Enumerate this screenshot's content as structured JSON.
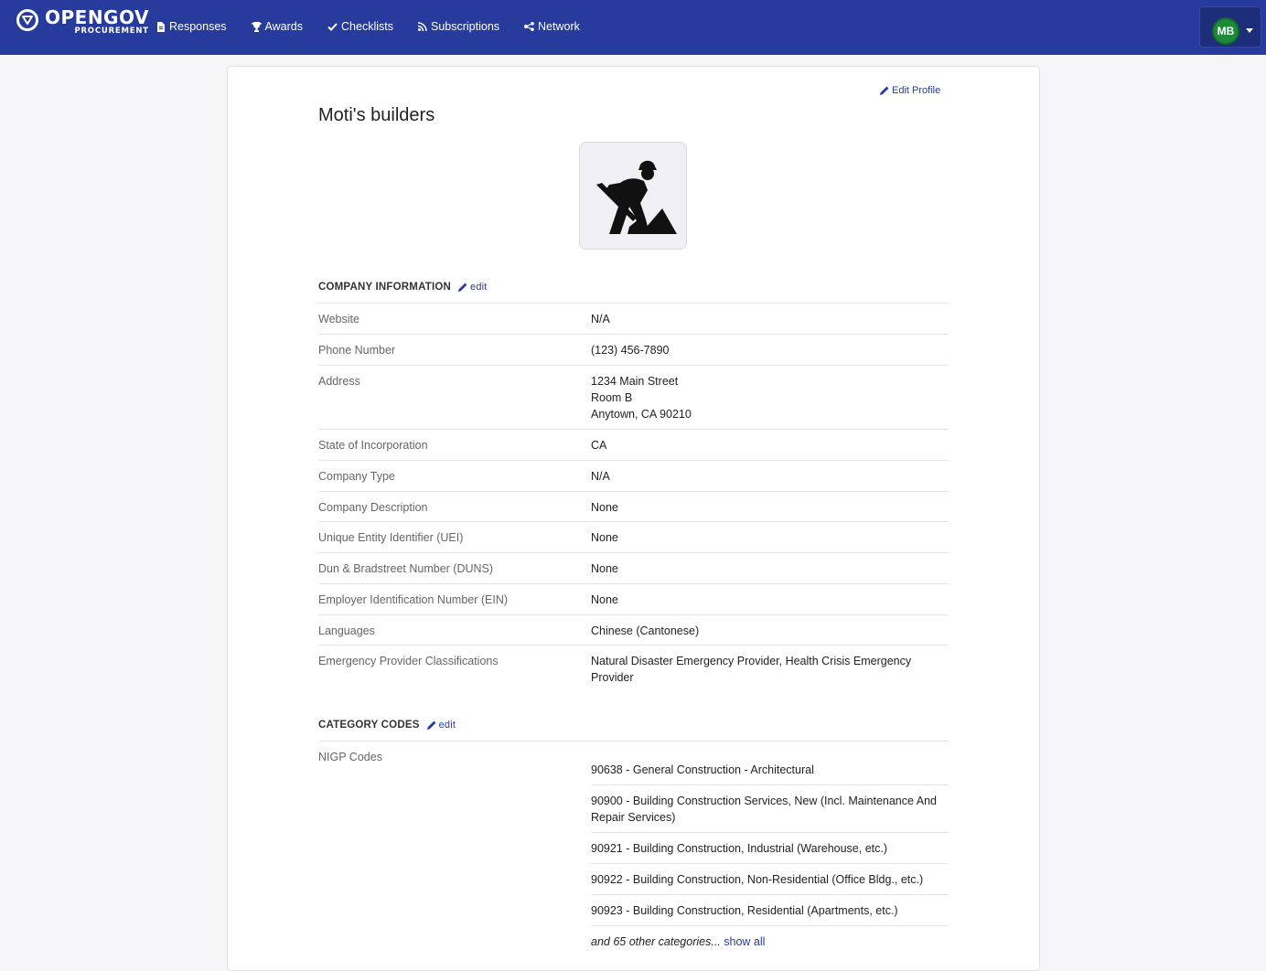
{
  "brand": {
    "name": "OPENGOV",
    "sub": "PROCUREMENT"
  },
  "nav": [
    {
      "label": "Responses",
      "icon": "file-icon"
    },
    {
      "label": "Awards",
      "icon": "trophy-icon"
    },
    {
      "label": "Checklists",
      "icon": "check-icon"
    },
    {
      "label": "Subscriptions",
      "icon": "rss-icon"
    },
    {
      "label": "Network",
      "icon": "share-icon"
    }
  ],
  "user": {
    "initials": "MB"
  },
  "profile": {
    "edit_label": "Edit Profile",
    "company_name": "Moti's builders",
    "logo_icon": "construction-worker-icon"
  },
  "company_info": {
    "title": "COMPANY INFORMATION",
    "edit_label": "edit",
    "rows": [
      {
        "label": "Website",
        "value": "N/A"
      },
      {
        "label": "Phone Number",
        "value": "(123) 456-7890"
      },
      {
        "label": "Address",
        "value_lines": [
          "1234 Main Street",
          "Room B",
          "Anytown, CA 90210"
        ]
      },
      {
        "label": "State of Incorporation",
        "value": "CA"
      },
      {
        "label": "Company Type",
        "value": "N/A"
      },
      {
        "label": "Company Description",
        "value": "None"
      },
      {
        "label": "Unique Entity Identifier (UEI)",
        "value": "None"
      },
      {
        "label": "Dun & Bradstreet Number (DUNS)",
        "value": "None"
      },
      {
        "label": "Employer Identification Number (EIN)",
        "value": "None"
      },
      {
        "label": "Languages",
        "value": "Chinese (Cantonese)"
      },
      {
        "label": "Emergency Provider Classifications",
        "value_lines": [
          "Natural Disaster Emergency Provider, Health Crisis Emergency",
          "Provider"
        ]
      }
    ]
  },
  "category_codes": {
    "title": "CATEGORY CODES",
    "edit_label": "edit",
    "nigp_label": "NIGP Codes",
    "codes": [
      {
        "lines": [
          "90638 - General Construction - Architectural"
        ]
      },
      {
        "lines": [
          "90900 - Building Construction Services, New (Incl. Maintenance And",
          "Repair Services)"
        ]
      },
      {
        "lines": [
          "90921 - Building Construction, Industrial (Warehouse, etc.)"
        ]
      },
      {
        "lines": [
          "90922 - Building Construction, Non-Residential (Office Bldg., etc.)"
        ]
      },
      {
        "lines": [
          "90923 - Building Construction, Residential (Apartments, etc.)"
        ]
      }
    ],
    "more_text": "and 65 other categories...",
    "show_all_label": "show all"
  },
  "colors": {
    "nav_bg": "#263b9b",
    "link": "#263b9b",
    "avatar_bg": "#1f8a3a"
  }
}
